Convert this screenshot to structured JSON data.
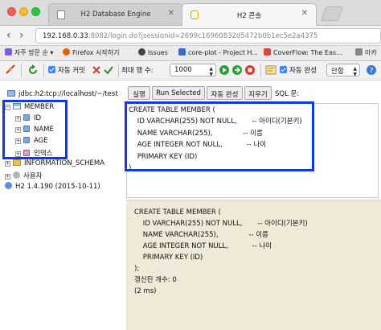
{
  "browser": {
    "tabs": [
      {
        "label": "H2 Database Engine",
        "active": false
      },
      {
        "label": "H2 콘솔",
        "active": true
      }
    ],
    "url_host": "192.168.0.33",
    "url_rest": ":8082/login.do?jsessionid=2699c16960832d5472b0b1ec5e2a4375",
    "bookmarks": [
      {
        "label": "자주 방문 순",
        "icon": "clock-icon",
        "color": "#7d5fd6"
      },
      {
        "label": "Firefox 시작하기",
        "icon": "firefox-icon",
        "color": "#e66000"
      },
      {
        "label": "Issues",
        "icon": "github-icon",
        "color": "#444444"
      },
      {
        "label": "core-plot - Project H...",
        "icon": "page-icon",
        "color": "#3b6fc4"
      },
      {
        "label": "CoverFlow: The Eas...",
        "icon": "page-icon",
        "color": "#d04a3a"
      },
      {
        "label": "아카",
        "icon": "page-icon",
        "color": "#888888"
      }
    ]
  },
  "toolbar": {
    "auto_commit_label": "자동 커밋",
    "max_rows_label": "최대 행 수:",
    "max_rows_value": "1000",
    "auto_complete_label": "자동 완성",
    "auto_complete_value": "안함"
  },
  "tree": {
    "connection": "jdbc:h2:tcp://localhost/~/test",
    "table": "MEMBER",
    "columns": [
      "ID",
      "NAME",
      "AGE"
    ],
    "index_label": "인덱스",
    "schema": "INFORMATION_SCHEMA",
    "users": "사용자",
    "version": "H2 1.4.190 (2015-10-11)"
  },
  "sql_buttons": {
    "run": "실행",
    "run_selected": "Run Selected",
    "auto_complete": "자동 완성",
    "clear": "지우기",
    "sql_label": "SQL 문:"
  },
  "editor_text": "CREATE TABLE MEMBER (\n    ID VARCHAR(255) NOT NULL,       -- 아이디(기본키)\n    NAME VARCHAR(255),              -- 이름\n    AGE INTEGER NOT NULL,           -- 나이\n    PRIMARY KEY (ID)\n)",
  "result": {
    "sql": "CREATE TABLE MEMBER (\n    ID VARCHAR(255) NOT NULL,       -- 아이디(기본키)\n    NAME VARCHAR(255),              -- 이름\n    AGE INTEGER NOT NULL,           -- 나이\n    PRIMARY KEY (ID)\n);",
    "update_count": "갱신된 개수: 0",
    "time": "(2 ms)"
  },
  "colors": {
    "highlight": "#1038e8",
    "result_bg": "#eeead7"
  }
}
